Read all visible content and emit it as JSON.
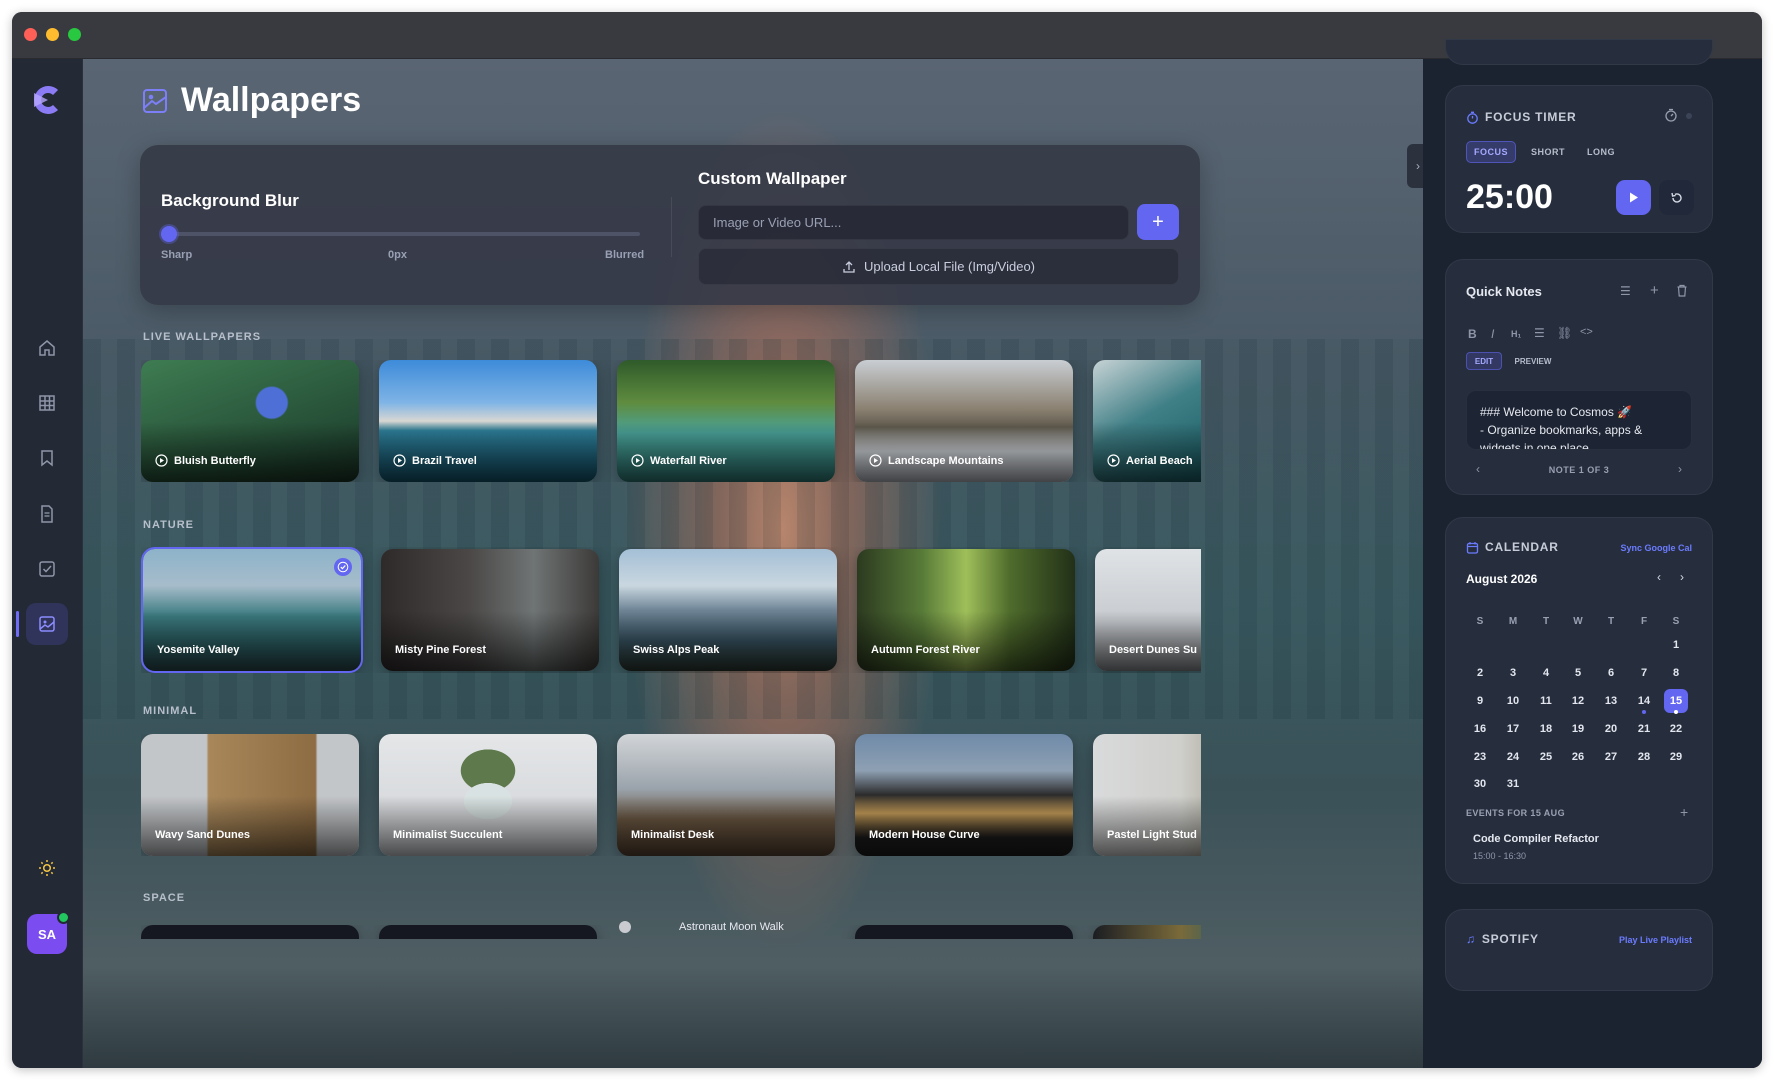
{
  "window": {
    "title": "Wallpapers"
  },
  "sidebar": {
    "items": [
      {
        "name": "home",
        "icon": "home-icon"
      },
      {
        "name": "apps",
        "icon": "grid-icon"
      },
      {
        "name": "bookmarks",
        "icon": "bookmark-icon"
      },
      {
        "name": "notes",
        "icon": "document-icon"
      },
      {
        "name": "tasks",
        "icon": "checkbox-icon"
      },
      {
        "name": "wallpapers",
        "icon": "image-icon",
        "active": true
      }
    ],
    "theme_icon": "sun-icon",
    "avatar_initials": "SA"
  },
  "main": {
    "title": "Wallpapers",
    "blur": {
      "title": "Background Blur",
      "min_label": "Sharp",
      "value_label": "0px",
      "max_label": "Blurred",
      "value": 0
    },
    "custom": {
      "title": "Custom Wallpaper",
      "url_placeholder": "Image or Video URL...",
      "add_label": "+",
      "upload_label": "Upload Local File (Img/Video)"
    },
    "sections": [
      {
        "label": "LIVE WALLPAPERS",
        "cards": [
          {
            "title": "Bluish Butterfly",
            "video": true
          },
          {
            "title": "Brazil Travel",
            "video": true
          },
          {
            "title": "Waterfall River",
            "video": true
          },
          {
            "title": "Landscape Mountains",
            "video": true
          },
          {
            "title": "Aerial Beach",
            "video": true
          }
        ]
      },
      {
        "label": "NATURE",
        "cards": [
          {
            "title": "Yosemite Valley",
            "selected": true
          },
          {
            "title": "Misty Pine Forest"
          },
          {
            "title": "Swiss Alps Peak"
          },
          {
            "title": "Autumn Forest River"
          },
          {
            "title": "Desert Dunes Su"
          }
        ]
      },
      {
        "label": "MINIMAL",
        "cards": [
          {
            "title": "Wavy Sand Dunes"
          },
          {
            "title": "Minimalist Succulent"
          },
          {
            "title": "Minimalist Desk"
          },
          {
            "title": "Modern House Curve"
          },
          {
            "title": "Pastel Light Stud"
          }
        ]
      },
      {
        "label": "SPACE",
        "cards": [
          {
            "title": ""
          },
          {
            "title": ""
          },
          {
            "title": "Astronaut Moon Walk"
          },
          {
            "title": ""
          },
          {
            "title": ""
          }
        ]
      }
    ]
  },
  "focus_timer": {
    "title": "FOCUS TIMER",
    "modes": [
      "FOCUS",
      "SHORT",
      "LONG"
    ],
    "active_mode": "FOCUS",
    "time": "25:00"
  },
  "quick_notes": {
    "title": "Quick Notes",
    "tabs": [
      "EDIT",
      "PREVIEW"
    ],
    "content_line1": "### Welcome to Cosmos 🚀",
    "content_line2": "- Organize bookmarks, apps &",
    "content_line3": "widgets in one place",
    "pager": "NOTE 1 OF 3"
  },
  "calendar": {
    "title": "CALENDAR",
    "sync_label": "Sync Google Cal",
    "month": "August 2026",
    "weekdays": [
      "S",
      "M",
      "T",
      "W",
      "T",
      "F",
      "S"
    ],
    "days": [
      "1",
      "2",
      "3",
      "4",
      "5",
      "6",
      "7",
      "8",
      "9",
      "10",
      "11",
      "12",
      "13",
      "14",
      "15",
      "16",
      "17",
      "18",
      "19",
      "20",
      "21",
      "22",
      "23",
      "24",
      "25",
      "26",
      "27",
      "28",
      "29",
      "30",
      "31"
    ],
    "today": 15,
    "events_label": "EVENTS FOR 15 AUG",
    "event_title": "Code Compiler Refactor",
    "event_time": "15:00 - 16:30"
  },
  "spotify": {
    "title": "SPOTIFY",
    "action": "Play Live Playlist"
  },
  "colors": {
    "accent": "#6366f1",
    "sidebar_bg": "#232935",
    "panel_bg": "#262e3e"
  }
}
